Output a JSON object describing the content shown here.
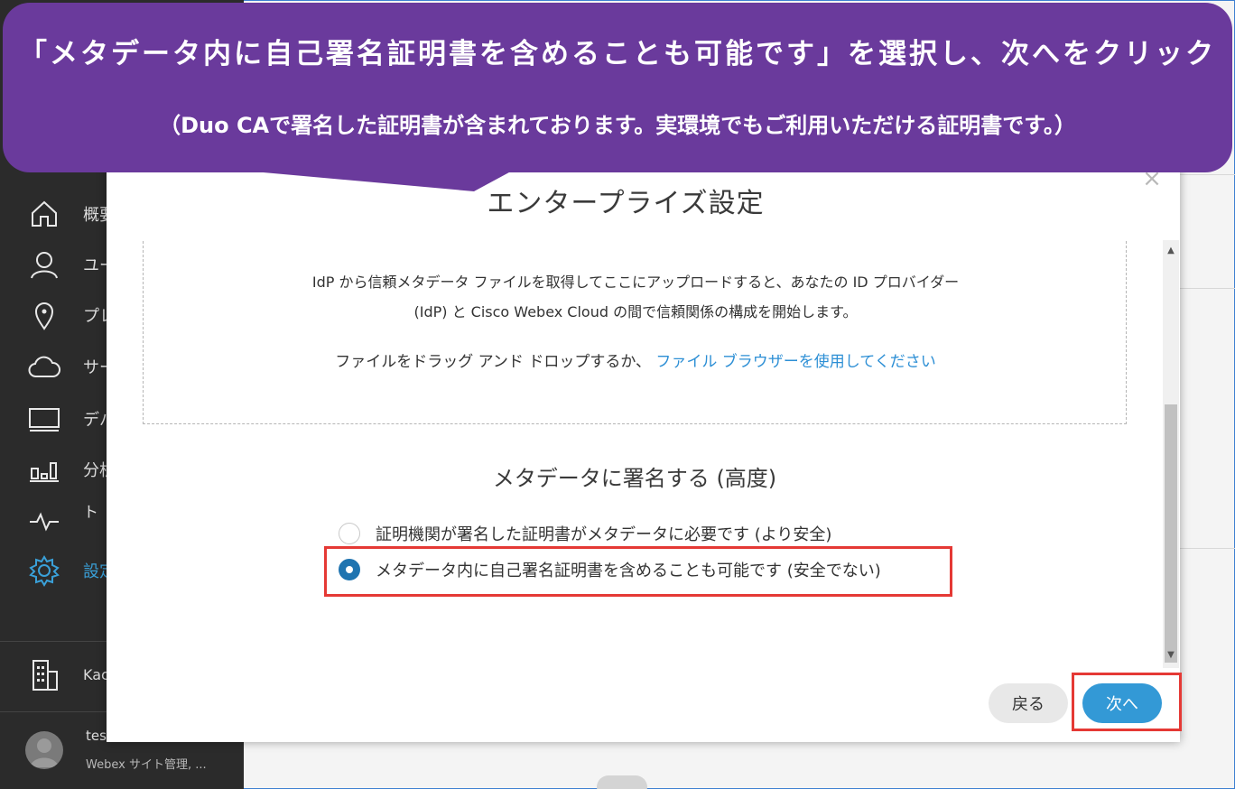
{
  "callout": {
    "line1": "「メタデータ内に自己署名証明書を含めることも可能です」を選択し、次へをクリック",
    "line2": "（Duo CAで署名した証明書が含まれております。実環境でもご利用いただける証明書です。）",
    "color": "#6a3a9c"
  },
  "sidebar": {
    "items": [
      {
        "label": "概要",
        "icon": "home-icon"
      },
      {
        "label": "ユーザー",
        "icon": "user-icon"
      },
      {
        "label": "プレイス",
        "icon": "location-pin-icon"
      },
      {
        "label": "サービス",
        "icon": "cloud-icon"
      },
      {
        "label": "デバイス",
        "icon": "device-icon"
      },
      {
        "label": "分析",
        "icon": "analytics-icon"
      },
      {
        "label": "トラブルシューティング",
        "icon": "pulse-icon"
      },
      {
        "label": "設定",
        "icon": "gear-icon"
      }
    ],
    "org": {
      "name": "Kac",
      "icon": "building-icon"
    },
    "user": {
      "name": "tes",
      "role": "Webex サイト管理, ..."
    }
  },
  "modal": {
    "title": "エンタープライズ設定",
    "close_label": "×",
    "dropzone": {
      "description": "IdP から信頼メタデータ ファイルを取得してここにアップロードすると、あなたの ID プロバイダー (IdP) と Cisco Webex Cloud の間で信頼関係の構成を開始します。",
      "drop_text": "ファイルをドラッグ アンド ドロップするか、",
      "browse_link": "ファイル ブラウザーを使用してください"
    },
    "signing": {
      "title": "メタデータに署名する (高度)",
      "options": [
        {
          "label": "証明機関が署名した証明書がメタデータに必要です (より安全)",
          "checked": false
        },
        {
          "label": "メタデータ内に自己署名証明書を含めることも可能です (安全でない)",
          "checked": true
        }
      ]
    },
    "buttons": {
      "back": "戻る",
      "next": "次へ"
    }
  },
  "colors": {
    "accent": "#3399d6",
    "highlight": "#e53935",
    "link": "#2d8fd5",
    "sidebar_bg": "#2b2b2b"
  }
}
